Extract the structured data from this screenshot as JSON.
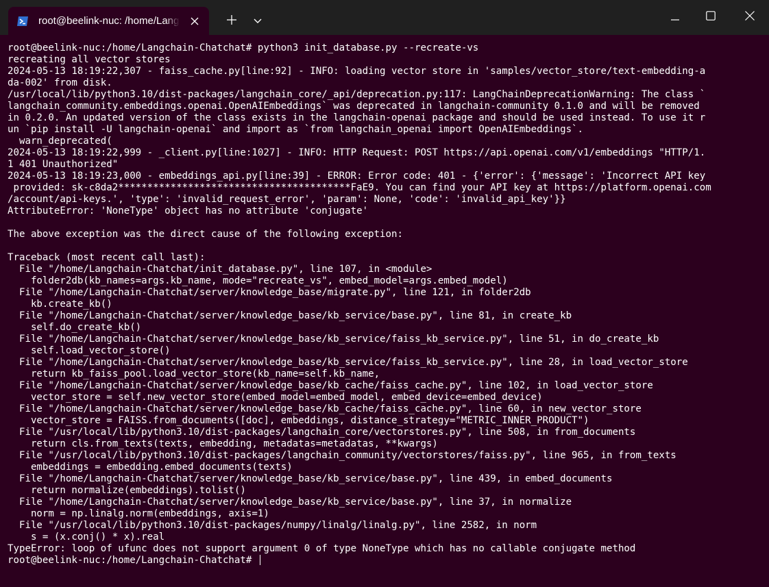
{
  "window": {
    "tab_title": "root@beelink-nuc: /home/Langchain-Chatchat",
    "tab_icon": "powershell-icon",
    "new_tab_icon": "plus-icon",
    "dropdown_icon": "chevron-down-icon",
    "controls": [
      "minimize-icon",
      "maximize-icon",
      "close-icon"
    ],
    "background": "#2c001e",
    "titlebar_bg": "#202020"
  },
  "terminal": {
    "lines": [
      "root@beelink-nuc:/home/Langchain-Chatchat# python3 init_database.py --recreate-vs",
      "recreating all vector stores",
      "2024-05-13 18:19:22,307 - faiss_cache.py[line:92] - INFO: loading vector store in 'samples/vector_store/text-embedding-a",
      "da-002' from disk.",
      "/usr/local/lib/python3.10/dist-packages/langchain_core/_api/deprecation.py:117: LangChainDeprecationWarning: The class `",
      "langchain_community.embeddings.openai.OpenAIEmbeddings` was deprecated in langchain-community 0.1.0 and will be removed",
      "in 0.2.0. An updated version of the class exists in the langchain-openai package and should be used instead. To use it r",
      "un `pip install -U langchain-openai` and import as `from langchain_openai import OpenAIEmbeddings`.",
      "  warn_deprecated(",
      "2024-05-13 18:19:22,999 - _client.py[line:1027] - INFO: HTTP Request: POST https://api.openai.com/v1/embeddings \"HTTP/1.",
      "1 401 Unauthorized\"",
      "2024-05-13 18:19:23,000 - embeddings_api.py[line:39] - ERROR: Error code: 401 - {'error': {'message': 'Incorrect API key",
      " provided: sk-c8da2****************************************FaE9. You can find your API key at https://platform.openai.com",
      "/account/api-keys.', 'type': 'invalid_request_error', 'param': None, 'code': 'invalid_api_key'}}",
      "AttributeError: 'NoneType' object has no attribute 'conjugate'",
      "",
      "The above exception was the direct cause of the following exception:",
      "",
      "Traceback (most recent call last):",
      "  File \"/home/Langchain-Chatchat/init_database.py\", line 107, in <module>",
      "    folder2db(kb_names=args.kb_name, mode=\"recreate_vs\", embed_model=args.embed_model)",
      "  File \"/home/Langchain-Chatchat/server/knowledge_base/migrate.py\", line 121, in folder2db",
      "    kb.create_kb()",
      "  File \"/home/Langchain-Chatchat/server/knowledge_base/kb_service/base.py\", line 81, in create_kb",
      "    self.do_create_kb()",
      "  File \"/home/Langchain-Chatchat/server/knowledge_base/kb_service/faiss_kb_service.py\", line 51, in do_create_kb",
      "    self.load_vector_store()",
      "  File \"/home/Langchain-Chatchat/server/knowledge_base/kb_service/faiss_kb_service.py\", line 28, in load_vector_store",
      "    return kb_faiss_pool.load_vector_store(kb_name=self.kb_name,",
      "  File \"/home/Langchain-Chatchat/server/knowledge_base/kb_cache/faiss_cache.py\", line 102, in load_vector_store",
      "    vector_store = self.new_vector_store(embed_model=embed_model, embed_device=embed_device)",
      "  File \"/home/Langchain-Chatchat/server/knowledge_base/kb_cache/faiss_cache.py\", line 60, in new_vector_store",
      "    vector_store = FAISS.from_documents([doc], embeddings, distance_strategy=\"METRIC_INNER_PRODUCT\")",
      "  File \"/usr/local/lib/python3.10/dist-packages/langchain_core/vectorstores.py\", line 508, in from_documents",
      "    return cls.from_texts(texts, embedding, metadatas=metadatas, **kwargs)",
      "  File \"/usr/local/lib/python3.10/dist-packages/langchain_community/vectorstores/faiss.py\", line 965, in from_texts",
      "    embeddings = embedding.embed_documents(texts)",
      "  File \"/home/Langchain-Chatchat/server/knowledge_base/kb_service/base.py\", line 439, in embed_documents",
      "    return normalize(embeddings).tolist()",
      "  File \"/home/Langchain-Chatchat/server/knowledge_base/kb_service/base.py\", line 37, in normalize",
      "    norm = np.linalg.norm(embeddings, axis=1)",
      "  File \"/usr/local/lib/python3.10/dist-packages/numpy/linalg/linalg.py\", line 2582, in norm",
      "    s = (x.conj() * x).real",
      "TypeError: loop of ufunc does not support argument 0 of type NoneType which has no callable conjugate method"
    ],
    "prompt": "root@beelink-nuc:/home/Langchain-Chatchat# "
  }
}
